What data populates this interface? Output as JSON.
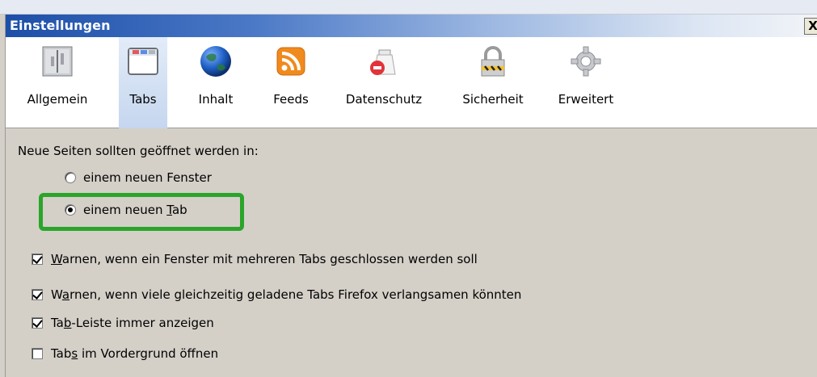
{
  "window": {
    "title": "Einstellungen",
    "close_label": "X"
  },
  "toolbar": {
    "panes": [
      {
        "label": "Allgemein",
        "icon": "general-switch-icon"
      },
      {
        "label": "Tabs",
        "icon": "tabs-window-icon"
      },
      {
        "label": "Inhalt",
        "icon": "globe-icon"
      },
      {
        "label": "Feeds",
        "icon": "rss-feed-icon"
      },
      {
        "label": "Datenschutz",
        "icon": "privacy-icon"
      },
      {
        "label": "Sicherheit",
        "icon": "padlock-icon"
      },
      {
        "label": "Erweitert",
        "icon": "gear-icon"
      }
    ],
    "selected": "Tabs"
  },
  "tabs_settings": {
    "open_in_heading": "Neue Seiten sollten geöffnet werden in:",
    "radio_window": {
      "pre": "einem neuen ",
      "accel": "F",
      "post": "enster",
      "checked": false
    },
    "radio_tab": {
      "pre": "einem neuen ",
      "accel": "T",
      "post": "ab",
      "checked": true
    },
    "checks": [
      {
        "pre": "",
        "accel": "W",
        "post": "arnen, wenn ein Fenster mit mehreren Tabs geschlossen werden soll",
        "checked": true
      },
      {
        "pre": "W",
        "accel": "a",
        "post": "rnen, wenn viele gleichzeitig geladene Tabs Firefox verlangsamen könnten",
        "checked": true
      },
      {
        "pre": "Ta",
        "accel": "b",
        "post": "-Leiste immer anzeigen",
        "checked": true
      },
      {
        "pre": "Tab",
        "accel": "s",
        "post": " im Vordergrund öffnen",
        "checked": false
      }
    ]
  },
  "colors": {
    "highlight": "#2aa52a",
    "title_bar": "#1d4fa8",
    "dialog_bg": "#d4d0c8"
  }
}
